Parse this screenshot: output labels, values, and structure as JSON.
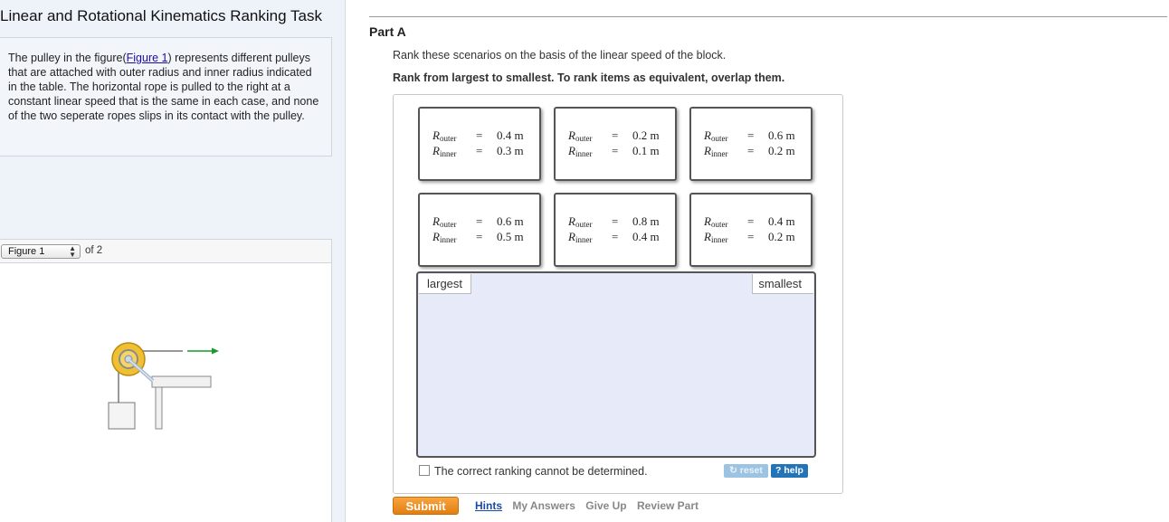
{
  "task": {
    "title": "Linear and Rotational Kinematics Ranking Task",
    "intro_before": "The pulley in the figure(",
    "intro_link": "Figure 1",
    "intro_after": ") represents different pulleys that are attached with outer radius and inner radius indicated in the table. The horizontal rope is pulled to the right at a constant linear speed that is the same in each case, and none of the two seperate ropes slips in its contact with the pulley."
  },
  "figure": {
    "selected": "Figure 1",
    "of_text": "of 2"
  },
  "part": {
    "title": "Part A",
    "instruction": "Rank these scenarios on the basis of the linear speed of the block.",
    "rank_instruction": "Rank from largest to smallest. To rank items as equivalent, overlap them."
  },
  "cards": [
    {
      "label_main": "R",
      "outer_sub": "outer",
      "inner_sub": "inner",
      "eq": "=",
      "outer": "0.4 m",
      "inner": "0.3 m"
    },
    {
      "label_main": "R",
      "outer_sub": "outer",
      "inner_sub": "inner",
      "eq": "=",
      "outer": "0.2 m",
      "inner": "0.1 m"
    },
    {
      "label_main": "R",
      "outer_sub": "outer",
      "inner_sub": "inner",
      "eq": "=",
      "outer": "0.6 m",
      "inner": "0.2 m"
    },
    {
      "label_main": "R",
      "outer_sub": "outer",
      "inner_sub": "inner",
      "eq": "=",
      "outer": "0.6 m",
      "inner": "0.5 m"
    },
    {
      "label_main": "R",
      "outer_sub": "outer",
      "inner_sub": "inner",
      "eq": "=",
      "outer": "0.8 m",
      "inner": "0.4 m"
    },
    {
      "label_main": "R",
      "outer_sub": "outer",
      "inner_sub": "inner",
      "eq": "=",
      "outer": "0.4 m",
      "inner": "0.2 m"
    }
  ],
  "ranking": {
    "largest_label": "largest",
    "smallest_label": "smallest",
    "cannot_determine": "The correct ranking cannot be determined."
  },
  "buttons": {
    "reset": "reset",
    "help": "? help",
    "submit": "Submit"
  },
  "footer": {
    "hints": "Hints",
    "my_answers": "My Answers",
    "give_up": "Give Up",
    "review_part": "Review Part"
  },
  "colors": {
    "submit": "#e98a1a",
    "help": "#2273b7",
    "reset": "#9dc3e3",
    "drop_zone": "#e6eaf9",
    "arrow": "#1a9a2a",
    "pulley": "#e8b828"
  }
}
